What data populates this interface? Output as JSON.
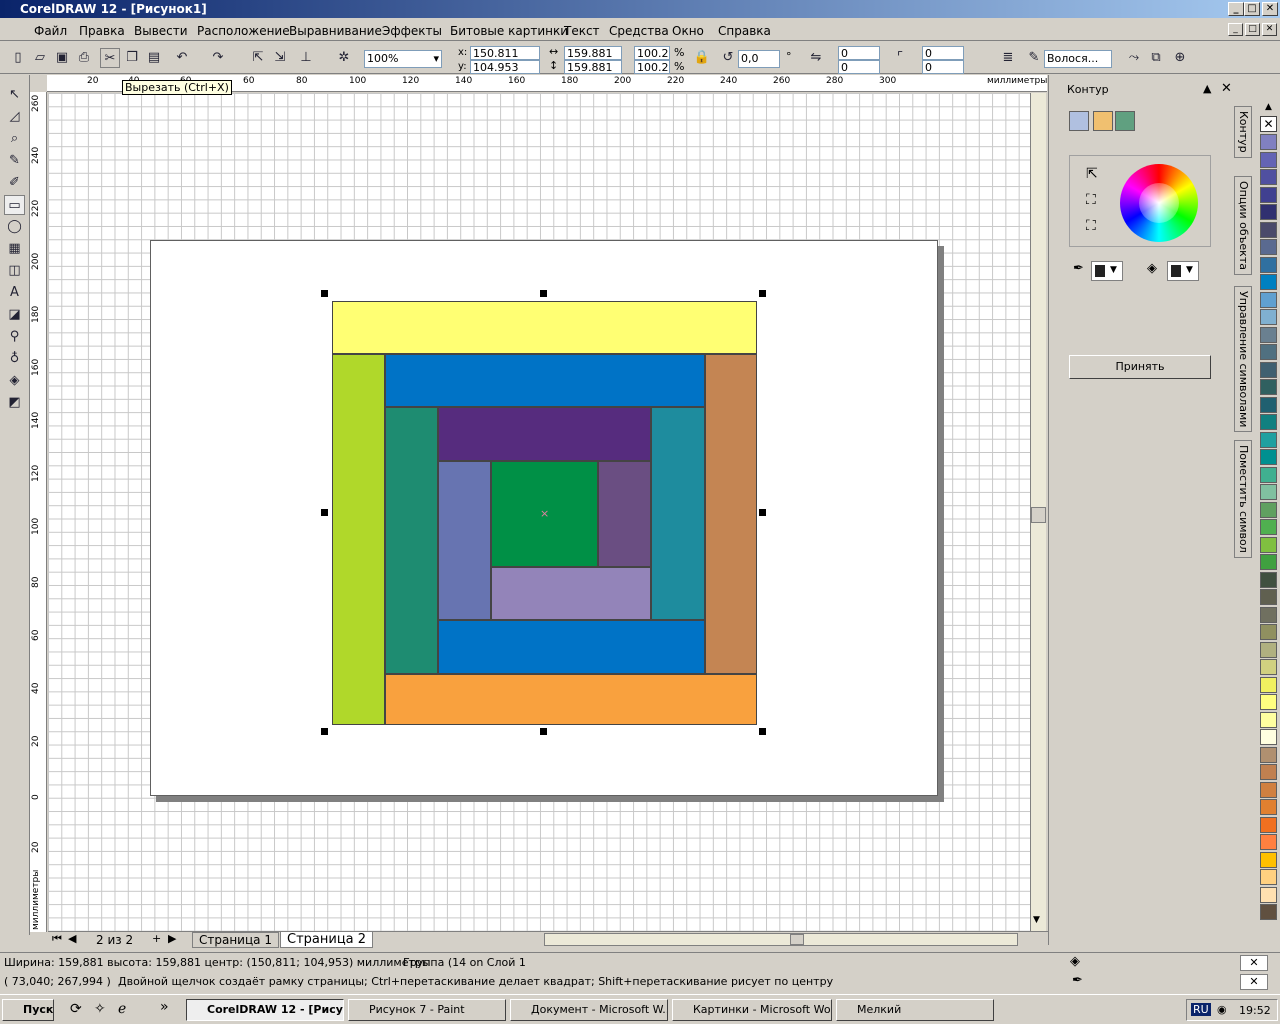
{
  "window": {
    "title": "CorelDRAW 12 - [Рисунок1]",
    "btn_min": "_",
    "btn_max": "□",
    "btn_close": "✕"
  },
  "menu": [
    "Файл",
    "Правка",
    "Вывести",
    "Расположение",
    "Выравнивание",
    "Эффекты",
    "Битовые картинки",
    "Текст",
    "Средства",
    "Окно",
    "Справка"
  ],
  "toolbar": {
    "zoom": "100%",
    "x": "150.811 mm",
    "y": "104.953 mm",
    "w": "159.881 mr",
    "h": "159.881 mr",
    "sx": "100.2",
    "sy": "100.2",
    "pct": "%",
    "angle": "0,0",
    "deg": "°",
    "n1": "0",
    "n2": "0",
    "n3": "0",
    "n4": "0",
    "outline": "Волося..."
  },
  "tooltip": "Вырезать (Ctrl+X)",
  "ruler": {
    "top": [
      "20",
      "40",
      "60",
      "80",
      "100",
      "120",
      "140",
      "160",
      "180",
      "200",
      "220",
      "240",
      "260",
      "280",
      "300"
    ],
    "unit": "миллиметры",
    "left": [
      "260",
      "240",
      "220",
      "200",
      "180",
      "160",
      "140",
      "120",
      "100",
      "80",
      "60",
      "40",
      "20",
      "0",
      "20"
    ],
    "left_unit": "миллиметры"
  },
  "pages": {
    "count": "2 из 2",
    "tab1": "Страница 1",
    "tab2": "Страница 2"
  },
  "docker": {
    "title": "Контур",
    "apply": "Принять"
  },
  "docker_tabs": [
    "Контур",
    "Опции объекта",
    "Управление символами",
    "Поместить символ"
  ],
  "status": {
    "line1": "Ширина: 159,881  высота: 159,881  центр: (150,811; 104,953)  миллиметры",
    "group": "Группа (14 on Слой 1",
    "coords": "( 73,040; 267,994 )",
    "hint": "Двойной щелчок создаёт рамку страницы; Ctrl+перетаскивание делает квадрат; Shift+перетаскивание рисует по центру"
  },
  "taskbar": {
    "start": "Пуск",
    "tasks": [
      "CorelDRAW 12 - [Рису...",
      "Рисунок 7 - Paint",
      "Документ - Microsoft W...",
      "Картинки - Microsoft Word",
      "Мелкий"
    ],
    "lang": "RU",
    "clock": "19:52"
  },
  "colors": {
    "yellow": "#ffff73",
    "lime": "#b0d82a",
    "blue": "#0073c6",
    "orange": "#c48553",
    "teal": "#1e8c71",
    "purple": "#562c7e",
    "cyan": "#1e8c9e",
    "periwinkle": "#6774b1",
    "green": "#009046",
    "mauve": "#6a4e82",
    "lavender": "#9384b9",
    "brightorange": "#f9a13e"
  },
  "palette": [
    "#8080c0",
    "#6464b4",
    "#5050a0",
    "#404090",
    "#303070",
    "#4a4a6a",
    "#5a6a90",
    "#3070a0",
    "#0080c0",
    "#60a0d0",
    "#80b0d0",
    "#6a8090",
    "#507080",
    "#406070",
    "#306060",
    "#206070",
    "#108080",
    "#20a0a0",
    "#009090",
    "#40b090",
    "#80c0a0",
    "#60a060",
    "#50b050",
    "#80c040",
    "#40a040",
    "#405040",
    "#606050",
    "#707060",
    "#909060",
    "#b0b080",
    "#d0d080",
    "#f0f060",
    "#ffff80",
    "#ffffa0",
    "#ffffe0",
    "#b09070",
    "#c08050",
    "#d08040",
    "#e08030",
    "#f07020",
    "#ff8040",
    "#ffc000",
    "#ffd080",
    "#ffe0b0",
    "#605040"
  ]
}
